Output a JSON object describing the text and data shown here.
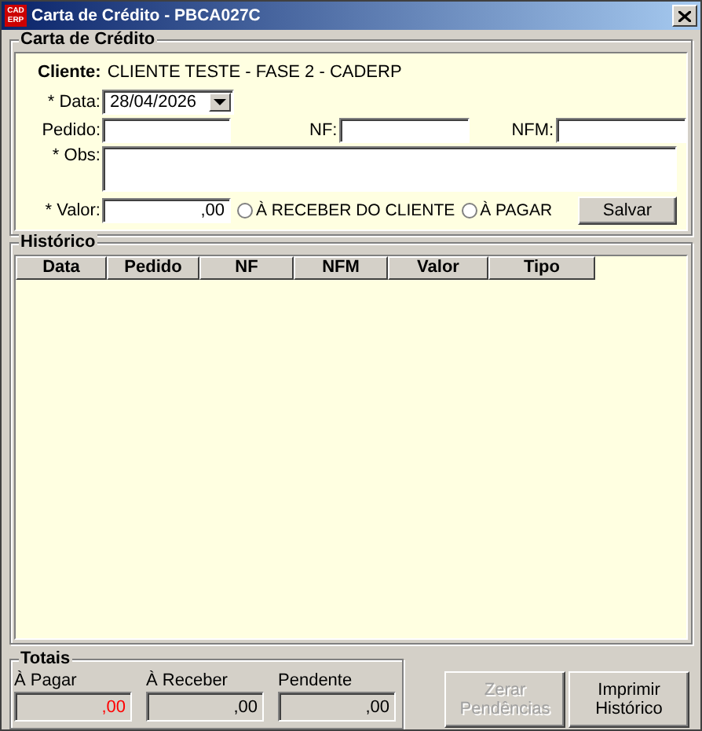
{
  "window": {
    "title": "Carta de Crédito - PBCA027C",
    "logo_top": "CAD",
    "logo_bottom": "ERP"
  },
  "form": {
    "legend": "Carta de Crédito",
    "client_label": "Cliente:",
    "client_value": "CLIENTE TESTE - FASE 2 - CADERP",
    "date_label": "* Data:",
    "date_value": "28/04/2026",
    "order_label": "Pedido:",
    "nf_label": "NF:",
    "nfm_label": "NFM:",
    "obs_label": "* Obs:",
    "value_label": "* Valor:",
    "value_value": ",00",
    "options": [
      {
        "label": "À RECEBER DO CLIENTE",
        "selected": false
      },
      {
        "label": "À PAGAR",
        "selected": false
      }
    ],
    "save": "Salvar"
  },
  "history": {
    "legend": "Histórico",
    "columns": [
      "Data",
      "Pedido",
      "NF",
      "NFM",
      "Valor",
      "Tipo"
    ]
  },
  "totals": {
    "legend": "Totais",
    "items": [
      {
        "label": "À Pagar",
        "value": ",00",
        "color": "#ff0000"
      },
      {
        "label": "À Receber",
        "value": ",00",
        "color": "#000000"
      },
      {
        "label": "Pendente",
        "value": ",00",
        "color": "#000000"
      }
    ]
  },
  "buttons": [
    {
      "label": "Zerar Pendências",
      "disabled": true
    },
    {
      "label": "Imprimir Histórico",
      "disabled": false
    }
  ]
}
